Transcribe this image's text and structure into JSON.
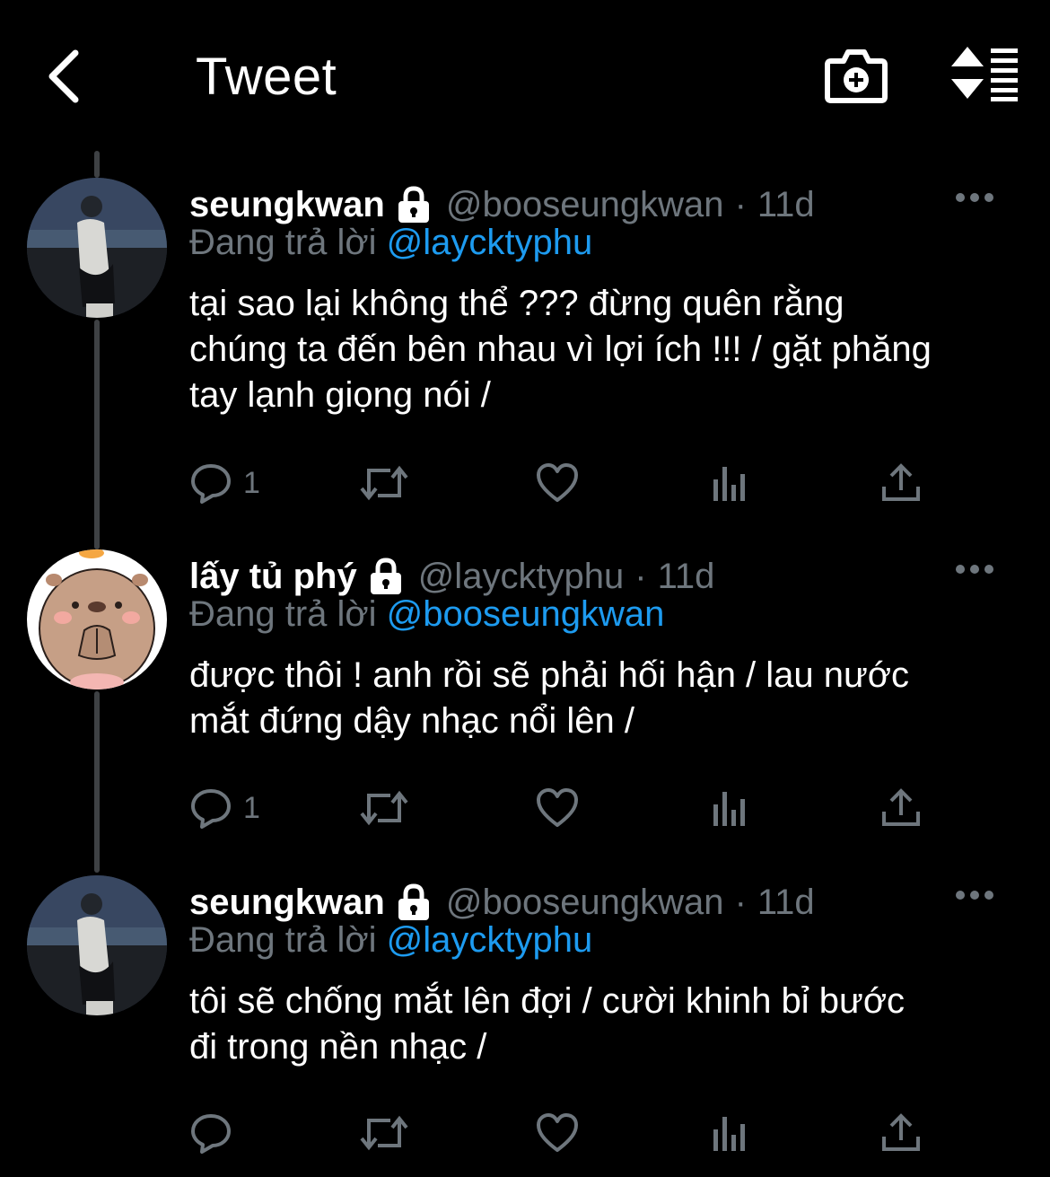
{
  "header": {
    "title": "Tweet",
    "back_icon": "chevron-left-icon",
    "camera_icon": "camera-add-icon",
    "sort_icon": "sort-icon"
  },
  "colors": {
    "background": "#000000",
    "text": "#ffffff",
    "muted": "#6e767d",
    "link": "#1d9bf0",
    "thread_line": "#3e4144"
  },
  "tweets": [
    {
      "display_name": "seungkwan",
      "handle": "@booseungkwan",
      "separator": "·",
      "time": "11d",
      "reply_label": "Đang trả lời",
      "reply_to": "@laycktyphu",
      "text": "tại sao lại không thể ??? đừng quên rằng\nchúng ta đến bên nhau vì lợi ích !!! / gặt phăng\ntay lạnh giọng nói /",
      "reply_count": "1",
      "avatar": "photo-avatar"
    },
    {
      "display_name": "lấy tủ phý",
      "handle": "@laycktyphu",
      "separator": "·",
      "time": "11d",
      "reply_label": "Đang trả lời",
      "reply_to": "@booseungkwan",
      "text": "được thôi ! anh rồi sẽ phải hối hận / lau nước\nmắt đứng dậy nhạc nổi lên /",
      "reply_count": "1",
      "avatar": "capybara-avatar"
    },
    {
      "display_name": "seungkwan",
      "handle": "@booseungkwan",
      "separator": "·",
      "time": "11d",
      "reply_label": "Đang trả lời",
      "reply_to": "@laycktyphu",
      "text": "tôi sẽ chống mắt lên đợi / cười khinh bỉ bước\nđi trong nền nhạc /",
      "reply_count": "",
      "avatar": "photo-avatar"
    }
  ]
}
